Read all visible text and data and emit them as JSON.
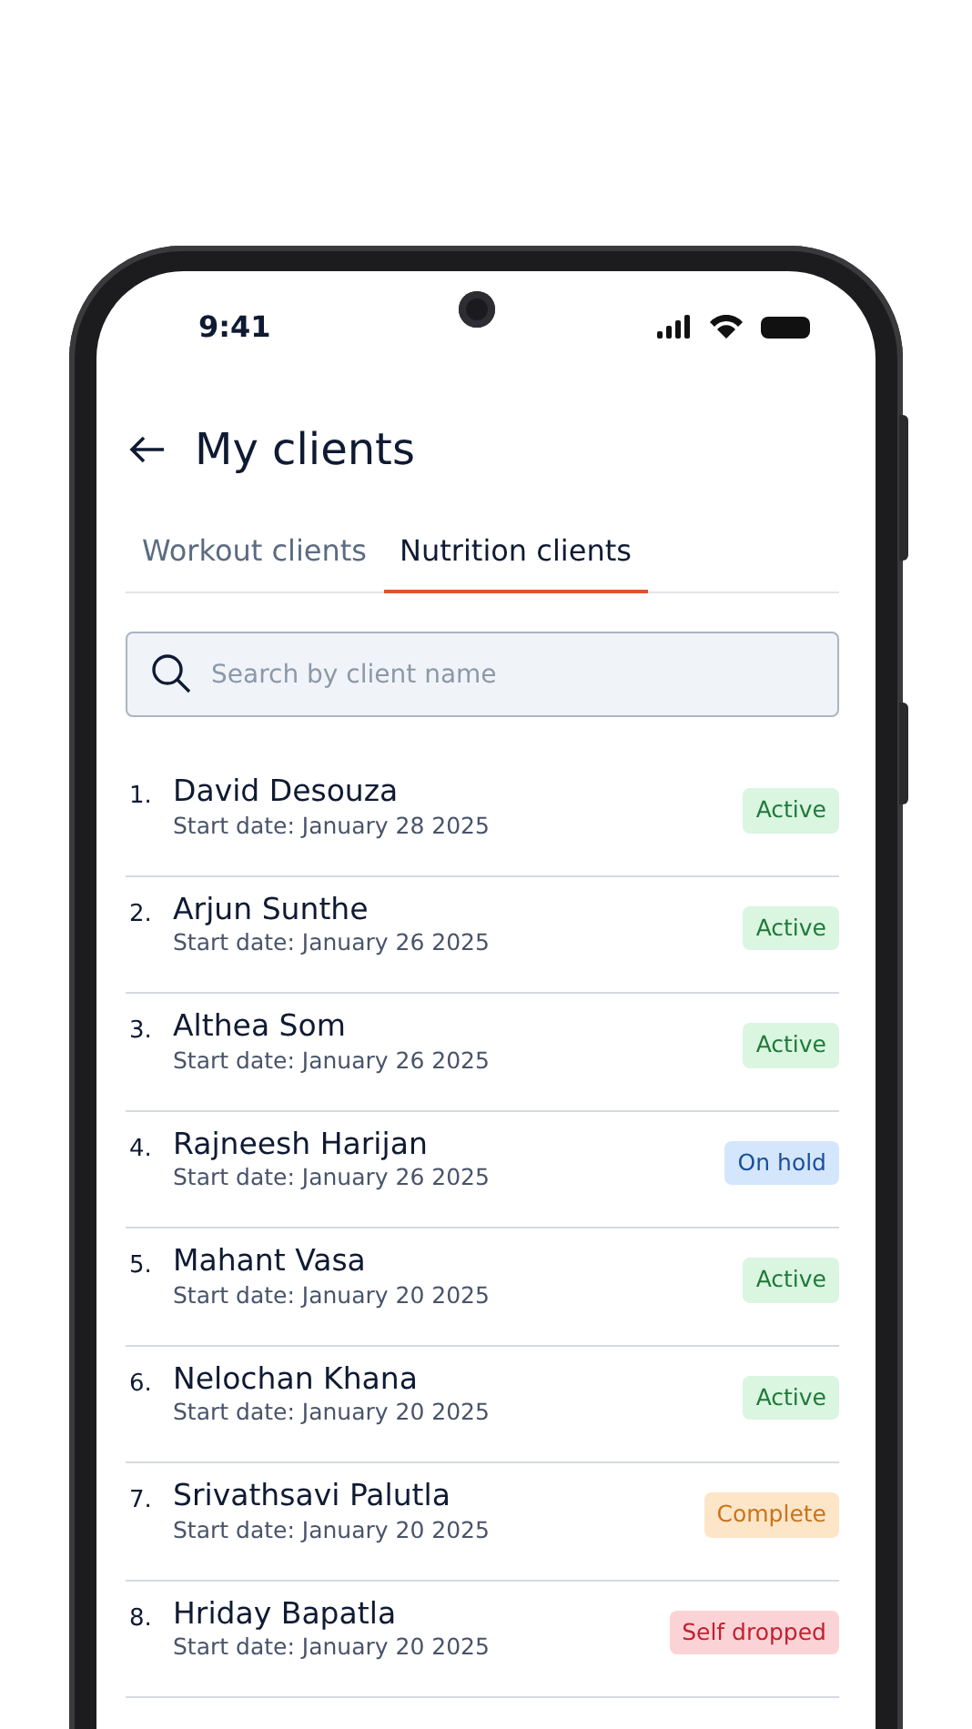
{
  "status_bar": {
    "time": "9:41"
  },
  "header": {
    "title": "My clients"
  },
  "tabs": [
    {
      "label": "Workout clients",
      "selected": false
    },
    {
      "label": "Nutrition clients",
      "selected": true
    }
  ],
  "search": {
    "placeholder": "Search by client name"
  },
  "clients": [
    {
      "number": "1.",
      "name": "David Desouza",
      "start_date": "Start date: January 28 2025",
      "status": "Active",
      "kind": "active"
    },
    {
      "number": "2.",
      "name": "Arjun Sunthe",
      "start_date": "Start date: January 26 2025",
      "status": "Active",
      "kind": "active"
    },
    {
      "number": "3.",
      "name": "Althea Som",
      "start_date": "Start date: January 26 2025",
      "status": "Active",
      "kind": "active"
    },
    {
      "number": "4.",
      "name": "Rajneesh Harijan",
      "start_date": "Start date: January 26 2025",
      "status": "On hold",
      "kind": "hold"
    },
    {
      "number": "5.",
      "name": "Mahant Vasa",
      "start_date": "Start date: January 20 2025",
      "status": "Active",
      "kind": "active"
    },
    {
      "number": "6.",
      "name": "Nelochan Khana",
      "start_date": "Start date: January 20 2025",
      "status": "Active",
      "kind": "active"
    },
    {
      "number": "7.",
      "name": "Srivathsavi Palutla",
      "start_date": "Start date: January 20 2025",
      "status": "Complete",
      "kind": "complete"
    },
    {
      "number": "8.",
      "name": "Hriday Bapatla",
      "start_date": "Start date: January 20 2025",
      "status": "Self dropped",
      "kind": "dropped"
    }
  ]
}
